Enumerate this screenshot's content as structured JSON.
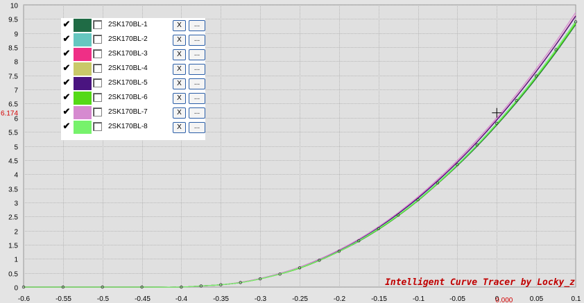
{
  "chart_data": {
    "type": "line",
    "title": "",
    "xlabel": "",
    "ylabel": "",
    "xlim": [
      -0.6,
      0.1
    ],
    "ylim": [
      0,
      10
    ],
    "x_ticks": [
      "-0.6",
      "-0.55",
      "-0.5",
      "-0.45",
      "-0.4",
      "-0.35",
      "-0.3",
      "-0.25",
      "-0.2",
      "-0.15",
      "-0.1",
      "-0.05",
      "0",
      "0.05",
      "0.1"
    ],
    "y_ticks": [
      "0",
      "0.5",
      "1",
      "1.5",
      "2",
      "2.5",
      "3",
      "3.5",
      "4",
      "4.5",
      "5",
      "5.5",
      "6",
      "6.5",
      "7",
      "7.5",
      "8",
      "8.5",
      "9",
      "9.5",
      "10"
    ],
    "grid": true,
    "legend": "top-left",
    "x": [
      -0.6,
      -0.55,
      -0.5,
      -0.45,
      -0.4,
      -0.375,
      -0.35,
      -0.325,
      -0.3,
      -0.275,
      -0.25,
      -0.225,
      -0.2,
      -0.175,
      -0.15,
      -0.125,
      -0.1,
      -0.075,
      -0.05,
      -0.025,
      0,
      0.025,
      0.05,
      0.075,
      0.1
    ],
    "series": [
      {
        "name": "2SK170BL-1",
        "color": "#1f6b45",
        "values": [
          0.0,
          0.0,
          0.0,
          0.0,
          0.0,
          0.04,
          0.08,
          0.16,
          0.29,
          0.46,
          0.67,
          0.94,
          1.26,
          1.62,
          2.04,
          2.52,
          3.06,
          3.66,
          4.3,
          4.99,
          5.74,
          6.54,
          7.4,
          8.32,
          9.3
        ]
      },
      {
        "name": "2SK170BL-2",
        "color": "#66c7c0",
        "values": [
          0.0,
          0.0,
          0.0,
          0.0,
          0.0,
          0.04,
          0.08,
          0.16,
          0.3,
          0.47,
          0.69,
          0.96,
          1.28,
          1.65,
          2.07,
          2.55,
          3.1,
          3.7,
          4.35,
          5.05,
          5.81,
          6.62,
          7.49,
          8.42,
          9.42
        ]
      },
      {
        "name": "2SK170BL-3",
        "color": "#ef2f86",
        "values": [
          0.0,
          0.0,
          0.0,
          0.0,
          0.0,
          0.04,
          0.08,
          0.17,
          0.3,
          0.48,
          0.7,
          0.98,
          1.31,
          1.69,
          2.12,
          2.61,
          3.16,
          3.77,
          4.43,
          5.15,
          5.93,
          6.76,
          7.65,
          8.6,
          9.62
        ]
      },
      {
        "name": "2SK170BL-4",
        "color": "#c9c969",
        "values": [
          0.0,
          0.0,
          0.0,
          0.0,
          0.0,
          0.04,
          0.08,
          0.16,
          0.29,
          0.46,
          0.68,
          0.95,
          1.27,
          1.64,
          2.06,
          2.54,
          3.08,
          3.68,
          4.33,
          5.03,
          5.78,
          6.59,
          7.45,
          8.37,
          9.36
        ]
      },
      {
        "name": "2SK170BL-5",
        "color": "#4a1480",
        "values": [
          0.0,
          0.0,
          0.0,
          0.0,
          0.0,
          0.04,
          0.08,
          0.16,
          0.3,
          0.48,
          0.7,
          0.97,
          1.3,
          1.68,
          2.11,
          2.6,
          3.15,
          3.76,
          4.42,
          5.14,
          5.92,
          6.75,
          7.64,
          8.59,
          9.6
        ]
      },
      {
        "name": "2SK170BL-6",
        "color": "#55d917",
        "values": [
          0.0,
          0.0,
          0.0,
          0.0,
          0.0,
          0.04,
          0.08,
          0.16,
          0.29,
          0.46,
          0.67,
          0.94,
          1.26,
          1.63,
          2.05,
          2.53,
          3.07,
          3.67,
          4.32,
          5.02,
          5.77,
          6.58,
          7.44,
          8.36,
          9.34
        ]
      },
      {
        "name": "2SK170BL-7",
        "color": "#d68ad0",
        "values": [
          0.0,
          0.0,
          0.0,
          0.0,
          0.0,
          0.04,
          0.08,
          0.17,
          0.3,
          0.48,
          0.71,
          0.99,
          1.32,
          1.7,
          2.14,
          2.64,
          3.2,
          3.82,
          4.49,
          5.22,
          6.0,
          6.84,
          7.74,
          8.7,
          9.73
        ]
      },
      {
        "name": "2SK170BL-8",
        "color": "#77f26c",
        "values": [
          0.0,
          0.0,
          0.0,
          0.0,
          0.0,
          0.04,
          0.08,
          0.16,
          0.29,
          0.46,
          0.68,
          0.95,
          1.27,
          1.64,
          2.07,
          2.55,
          3.09,
          3.69,
          4.34,
          5.04,
          5.8,
          6.61,
          7.48,
          8.41,
          9.4
        ]
      }
    ],
    "cursor": {
      "x": 0,
      "y": 6.174,
      "x_readout": "0.000",
      "y_readout": "6.174"
    },
    "watermark": "Intelligent Curve Tracer by Locky_z"
  },
  "colors": {
    "background": "#e4e4e4",
    "plot_background": "#e0e0e0",
    "grid": "#bdbdbd",
    "axis_text": "#000000",
    "readout": "#d40000",
    "watermark": "#c00000"
  }
}
